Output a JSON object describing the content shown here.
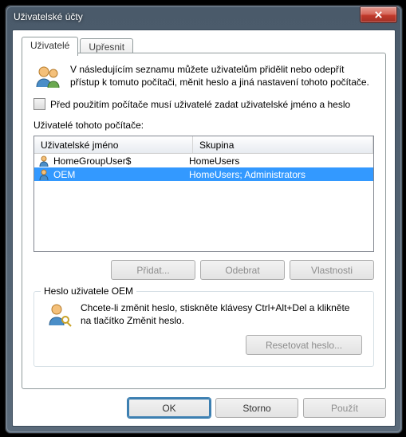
{
  "window": {
    "title": "Uživatelské účty"
  },
  "tabs": {
    "users": "Uživatelé",
    "advanced": "Upřesnit"
  },
  "intro": "V následujícím seznamu můžete uživatelům přidělit nebo odepřít přístup k tomuto počítači, měnit heslo a jiná nastavení tohoto počítače.",
  "checkbox_label": "Před použitím počítače musí uživatelé zadat uživatelské jméno a heslo",
  "users_label": "Uživatelé tohoto počítače:",
  "columns": {
    "name": "Uživatelské jméno",
    "group": "Skupina"
  },
  "rows": [
    {
      "name": "HomeGroupUser$",
      "group": "HomeUsers",
      "selected": false
    },
    {
      "name": "OEM",
      "group": "HomeUsers; Administrators",
      "selected": true
    }
  ],
  "buttons": {
    "add": "Přidat...",
    "remove": "Odebrat",
    "properties": "Vlastnosti"
  },
  "group": {
    "title": "Heslo uživatele OEM",
    "text": "Chcete-li změnit heslo, stiskněte klávesy Ctrl+Alt+Del a klikněte na tlačítko Změnit heslo.",
    "reset": "Resetovat heslo..."
  },
  "bottom": {
    "ok": "OK",
    "cancel": "Storno",
    "apply": "Použít"
  }
}
